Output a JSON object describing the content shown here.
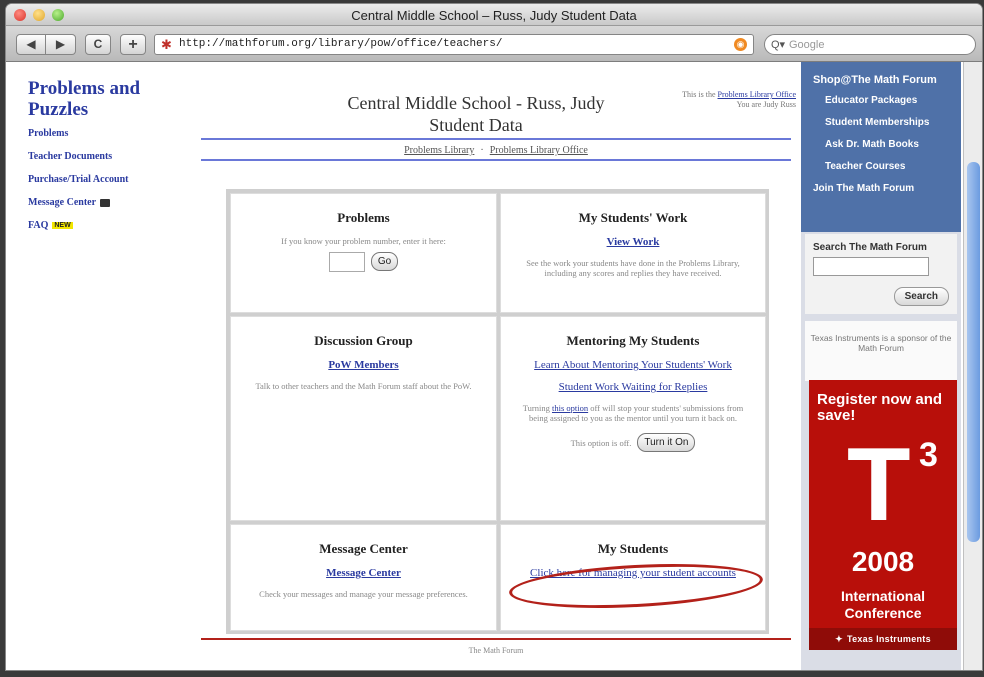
{
  "window": {
    "title": "Central Middle School – Russ, Judy Student Data"
  },
  "toolbar": {
    "back_label": "◀",
    "forward_label": "▶",
    "reload_label": "C",
    "add_label": "+",
    "url": "http://mathforum.org/library/pow/office/teachers/",
    "search_placeholder": "Google"
  },
  "leftnav": {
    "title": "Problems and Puzzles",
    "items": [
      {
        "label": "Problems"
      },
      {
        "label": "Teacher Documents"
      },
      {
        "label": "Purchase/Trial Account"
      },
      {
        "label": "Message Center"
      },
      {
        "label": "FAQ",
        "badge": "NEW"
      }
    ]
  },
  "header": {
    "title": "Central Middle School - Russ, Judy Student Data",
    "note_prefix": "This is the",
    "note_link": "Problems Library Office",
    "note_user": "You are Judy Russ",
    "crumb1": "Problems Library",
    "crumb_sep": "·",
    "crumb2": "Problems Library Office"
  },
  "cells": {
    "problems": {
      "title": "Problems",
      "desc": "If you know your problem number, enter it here:",
      "go_label": "Go"
    },
    "students_work": {
      "title": "My Students' Work",
      "link": "View Work",
      "desc": "See the work your students have done in the Problems Library, including any scores and replies they have received."
    },
    "discussion": {
      "title": "Discussion Group",
      "link": "PoW Members",
      "desc": "Talk to other teachers and the Math Forum staff about the PoW."
    },
    "mentoring": {
      "title": "Mentoring My Students",
      "link1": "Learn About Mentoring Your Students' Work",
      "link2": "Student Work Waiting for Replies",
      "desc_prefix": "Turning",
      "desc_link": "this option",
      "desc_suffix": "off will stop your students' submissions from being assigned to you as the mentor until you turn it back on.",
      "toggle_status": "This option is off.",
      "toggle_button": "Turn it On"
    },
    "message_center": {
      "title": "Message Center",
      "link": "Message Center",
      "desc": "Check your messages and manage your message preferences."
    },
    "my_students": {
      "title": "My Students",
      "link": "Click here for managing your student accounts"
    }
  },
  "footer": {
    "text": "The Math Forum"
  },
  "rightbar": {
    "shop_title": "Shop@The Math Forum",
    "shop_items": [
      "Educator Packages",
      "Student Memberships",
      "Ask Dr. Math Books",
      "Teacher Courses",
      "Join The Math Forum"
    ],
    "search_label": "Search The Math Forum",
    "search_button": "Search",
    "sponsor_text": "Texas Instruments is a sponsor of the Math Forum",
    "ad": {
      "headline": "Register now and save!",
      "big_t": "T",
      "sup": "3",
      "year": "2008",
      "conference": "International Conference",
      "brand": "Texas Instruments"
    }
  },
  "colors": {
    "nav_link": "#2a3aa0",
    "rule_blue": "#6a78d8",
    "highlight_red": "#b3211a",
    "shop_blue": "#4f71a8",
    "ad_red": "#b80f0a"
  }
}
